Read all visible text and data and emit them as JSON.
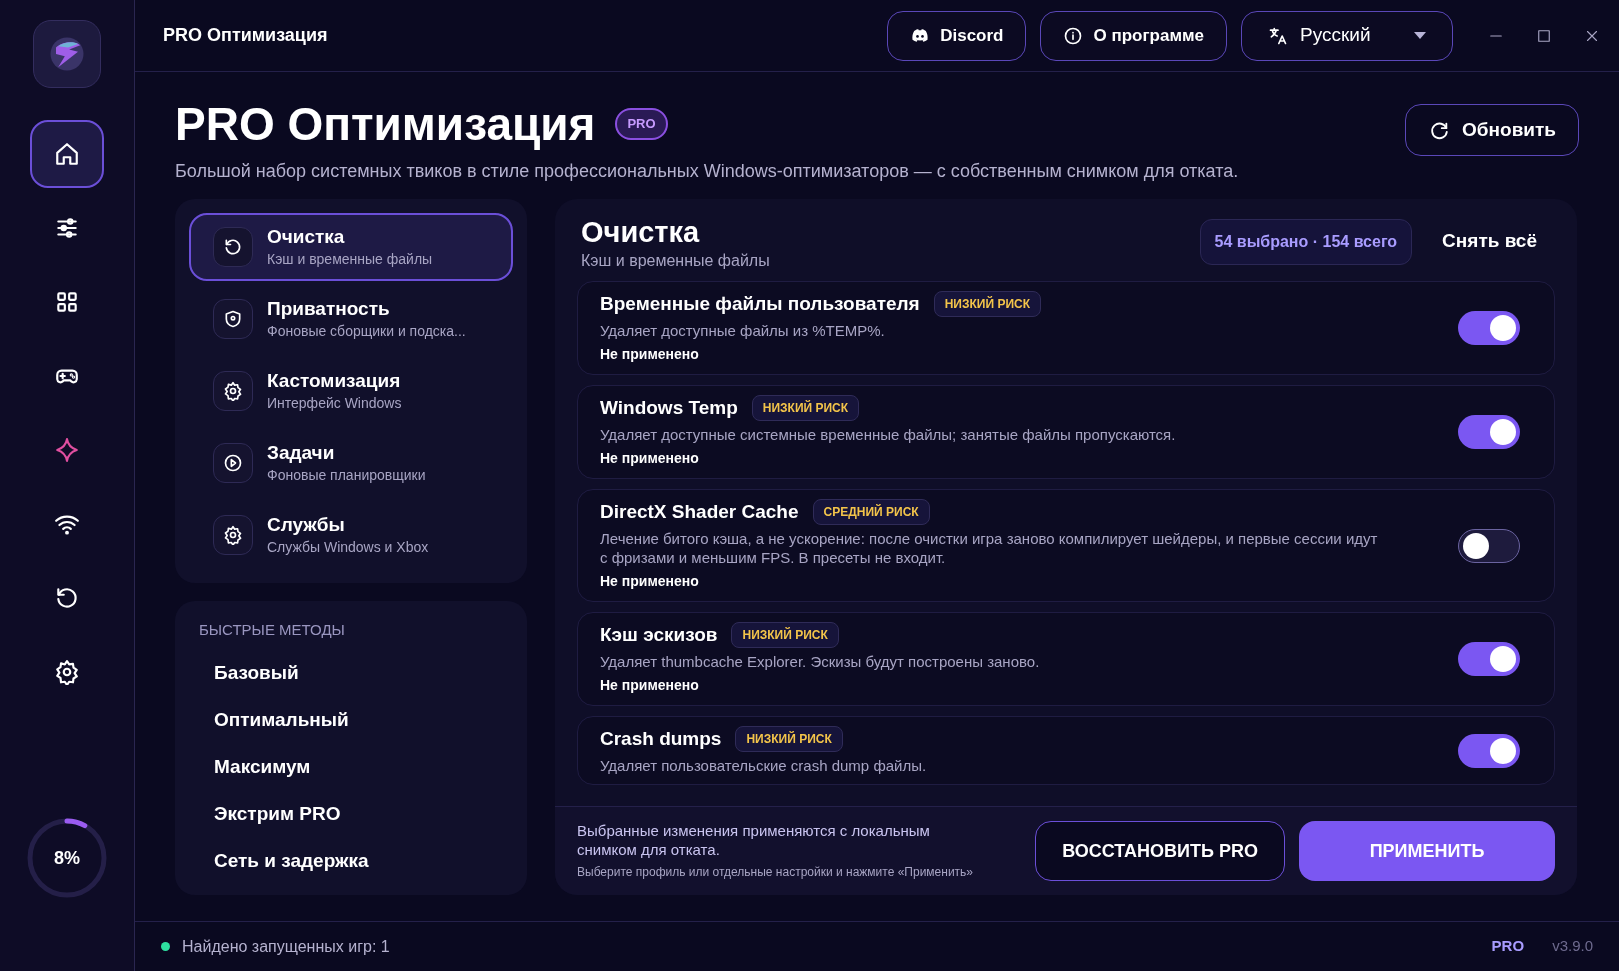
{
  "window": {
    "title": "PRO Оптимизация"
  },
  "header_buttons": [
    {
      "kind": "discord",
      "label": "Discord"
    },
    {
      "kind": "info",
      "label": "О программе"
    }
  ],
  "language": {
    "value": "Русский"
  },
  "sidebar": {
    "items": [
      {
        "kind": "home",
        "selected": true
      },
      {
        "kind": "sliders",
        "selected": false
      },
      {
        "kind": "grid",
        "selected": false
      },
      {
        "kind": "gamepad",
        "selected": false
      },
      {
        "kind": "sparkle",
        "selected": false
      },
      {
        "kind": "wifi",
        "selected": false
      },
      {
        "kind": "undo",
        "selected": false
      },
      {
        "kind": "gear",
        "selected": false
      }
    ],
    "progress": {
      "level": 0.08,
      "label": "8%"
    }
  },
  "page": {
    "title": "PRO Оптимизация",
    "badge": "PRO",
    "subtitle": "Большой набор системных твиков в стиле профессиональных Windows-оптимизаторов — с собственным снимком для отката.",
    "refresh": "Обновить"
  },
  "categories": [
    {
      "title": "Очистка",
      "subtitle": "Кэш и временные файлы",
      "selected": true
    },
    {
      "title": "Приватность",
      "subtitle": "Фоновые сборщики и подска...",
      "selected": false
    },
    {
      "title": "Кастомизация",
      "subtitle": "Интерфейс Windows",
      "selected": false
    },
    {
      "title": "Задачи",
      "subtitle": "Фоновые планировщики",
      "selected": false
    },
    {
      "title": "Службы",
      "subtitle": "Службы Windows и Xbox",
      "selected": false
    }
  ],
  "quick_methods": {
    "title": "БЫСТРЫЕ МЕТОДЫ",
    "items": [
      "Базовый",
      "Оптимальный",
      "Максимум",
      "Экстрим PRO",
      "Сеть и задержка"
    ]
  },
  "section": {
    "title": "Очистка",
    "subtitle": "Кэш и временные файлы",
    "count": "54 выбрано · 154 всего",
    "clear_all": "Снять всё"
  },
  "tweaks": [
    {
      "name": "Временные файлы пользователя",
      "risk": "НИЗКИЙ РИСК",
      "description": "Удаляет доступные файлы из %TEMP%.",
      "status": "Не применено",
      "on": true
    },
    {
      "name": "Windows Temp",
      "risk": "НИЗКИЙ РИСК",
      "description": "Удаляет доступные системные временные файлы; занятые файлы пропускаются.",
      "status": "Не применено",
      "on": true
    },
    {
      "name": "DirectX Shader Cache",
      "risk": "СРЕДНИЙ РИСК",
      "description": "Лечение битого кэша, а не ускорение: после очистки игра заново компилирует шейдеры, и первые сессии идут с фризами и меньшим FPS. В пресеты не входит.",
      "status": "Не применено",
      "on": false
    },
    {
      "name": "Кэш эскизов",
      "risk": "НИЗКИЙ РИСК",
      "description": "Удаляет thumbcache Explorer. Эскизы будут построены заново.",
      "status": "Не применено",
      "on": true
    },
    {
      "name": "Crash dumps",
      "risk": "НИЗКИЙ РИСК",
      "description": "Удаляет пользовательские crash dump файлы.",
      "on": true
    }
  ],
  "footer": {
    "note": "Выбранные изменения применяются с локальным снимком для отката.",
    "hint": "Выберите профиль или отдельные настройки и нажмите «Применить»",
    "restore": "ВОССТАНОВИТЬ PRO",
    "apply": "ПРИМЕНИТЬ"
  },
  "status_bar": {
    "games": "Найдено запущенных игр: 1",
    "edition": "PRO",
    "version": "v3.9.0"
  }
}
